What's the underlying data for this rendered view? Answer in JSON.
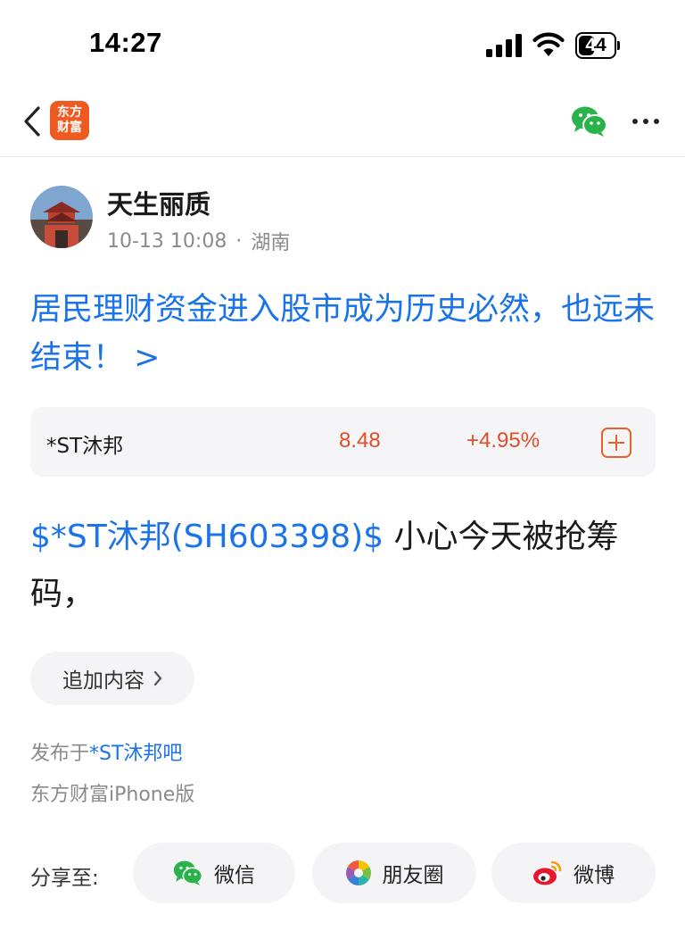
{
  "status_bar": {
    "time": "14:27",
    "battery_level": "44",
    "battery_fraction": 0.44
  },
  "nav": {
    "logo_line1": "东方",
    "logo_line2": "财富"
  },
  "author": {
    "name": "天生丽质",
    "timestamp": "10-13 10:08",
    "separator": "·",
    "location": "湖南"
  },
  "post": {
    "title": "居民理财资金进入股市成为历史必然，也远未结束！ >",
    "stock_link": "$*ST沐邦(SH603398)$",
    "body_text": "  小心今天被抢筹码，"
  },
  "stock_card": {
    "name": "*ST沐邦",
    "price": "8.48",
    "change": "+4.95%"
  },
  "actions": {
    "append_label": "追加内容",
    "append_chevron": "›"
  },
  "footer": {
    "published_prefix": "发布于",
    "bar_name": "*ST沐邦吧",
    "client": "东方财富iPhone版"
  },
  "share": {
    "label": "分享至:",
    "wechat": "微信",
    "moments": "朋友圈",
    "weibo": "微博"
  },
  "colors": {
    "link_blue": "#1a73e8",
    "price_red": "#e04e27",
    "brand_orange": "#ef5a20",
    "wechat_green": "#2ab34a"
  }
}
